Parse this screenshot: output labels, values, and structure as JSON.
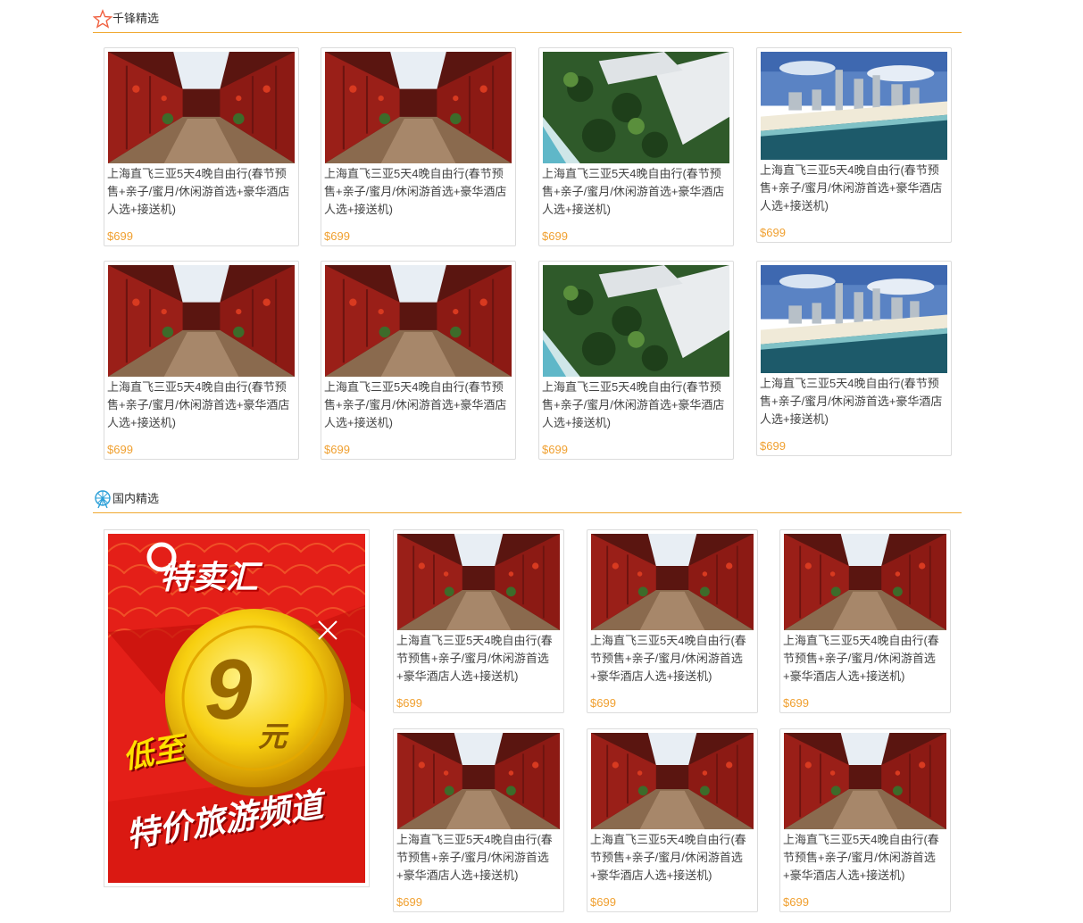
{
  "sections": {
    "featured": {
      "title": "千锋精选"
    },
    "domestic": {
      "title": "国内精选"
    }
  },
  "promo": {
    "logo": "特卖汇",
    "low": "低至",
    "amount": "9",
    "unit": "元",
    "channel": "特价旅游频道"
  },
  "featured_cards": [
    {
      "image": "old-street",
      "title": "上海直飞三亚5天4晚自由行(春节预售+亲子/蜜月/休闲游首选+豪华酒店人选+接送机)",
      "price": "$699"
    },
    {
      "image": "old-street",
      "title": "上海直飞三亚5天4晚自由行(春节预售+亲子/蜜月/休闲游首选+豪华酒店人选+接送机)",
      "price": "$699"
    },
    {
      "image": "resort",
      "title": "上海直飞三亚5天4晚自由行(春节预售+亲子/蜜月/休闲游首选+豪华酒店人选+接送机)",
      "price": "$699"
    },
    {
      "image": "city-beach",
      "title": "上海直飞三亚5天4晚自由行(春节预售+亲子/蜜月/休闲游首选+豪华酒店人选+接送机)",
      "price": "$699"
    },
    {
      "image": "old-street",
      "title": "上海直飞三亚5天4晚自由行(春节预售+亲子/蜜月/休闲游首选+豪华酒店人选+接送机)",
      "price": "$699"
    },
    {
      "image": "old-street",
      "title": "上海直飞三亚5天4晚自由行(春节预售+亲子/蜜月/休闲游首选+豪华酒店人选+接送机)",
      "price": "$699"
    },
    {
      "image": "resort",
      "title": "上海直飞三亚5天4晚自由行(春节预售+亲子/蜜月/休闲游首选+豪华酒店人选+接送机)",
      "price": "$699"
    },
    {
      "image": "city-beach",
      "title": "上海直飞三亚5天4晚自由行(春节预售+亲子/蜜月/休闲游首选+豪华酒店人选+接送机)",
      "price": "$699"
    }
  ],
  "domestic_cards": [
    {
      "image": "old-street",
      "title": "上海直飞三亚5天4晚自由行(春节预售+亲子/蜜月/休闲游首选+豪华酒店人选+接送机)",
      "price": "$699"
    },
    {
      "image": "old-street",
      "title": "上海直飞三亚5天4晚自由行(春节预售+亲子/蜜月/休闲游首选+豪华酒店人选+接送机)",
      "price": "$699"
    },
    {
      "image": "old-street",
      "title": "上海直飞三亚5天4晚自由行(春节预售+亲子/蜜月/休闲游首选+豪华酒店人选+接送机)",
      "price": "$699"
    },
    {
      "image": "old-street",
      "title": "上海直飞三亚5天4晚自由行(春节预售+亲子/蜜月/休闲游首选+豪华酒店人选+接送机)",
      "price": "$699"
    },
    {
      "image": "old-street",
      "title": "上海直飞三亚5天4晚自由行(春节预售+亲子/蜜月/休闲游首选+豪华酒店人选+接送机)",
      "price": "$699"
    },
    {
      "image": "old-street",
      "title": "上海直飞三亚5天4晚自由行(春节预售+亲子/蜜月/休闲游首选+豪华酒店人选+接送机)",
      "price": "$699"
    }
  ],
  "colors": {
    "accent": "#f0a830",
    "price": "#f0a030",
    "promo_red": "#e8231c"
  }
}
